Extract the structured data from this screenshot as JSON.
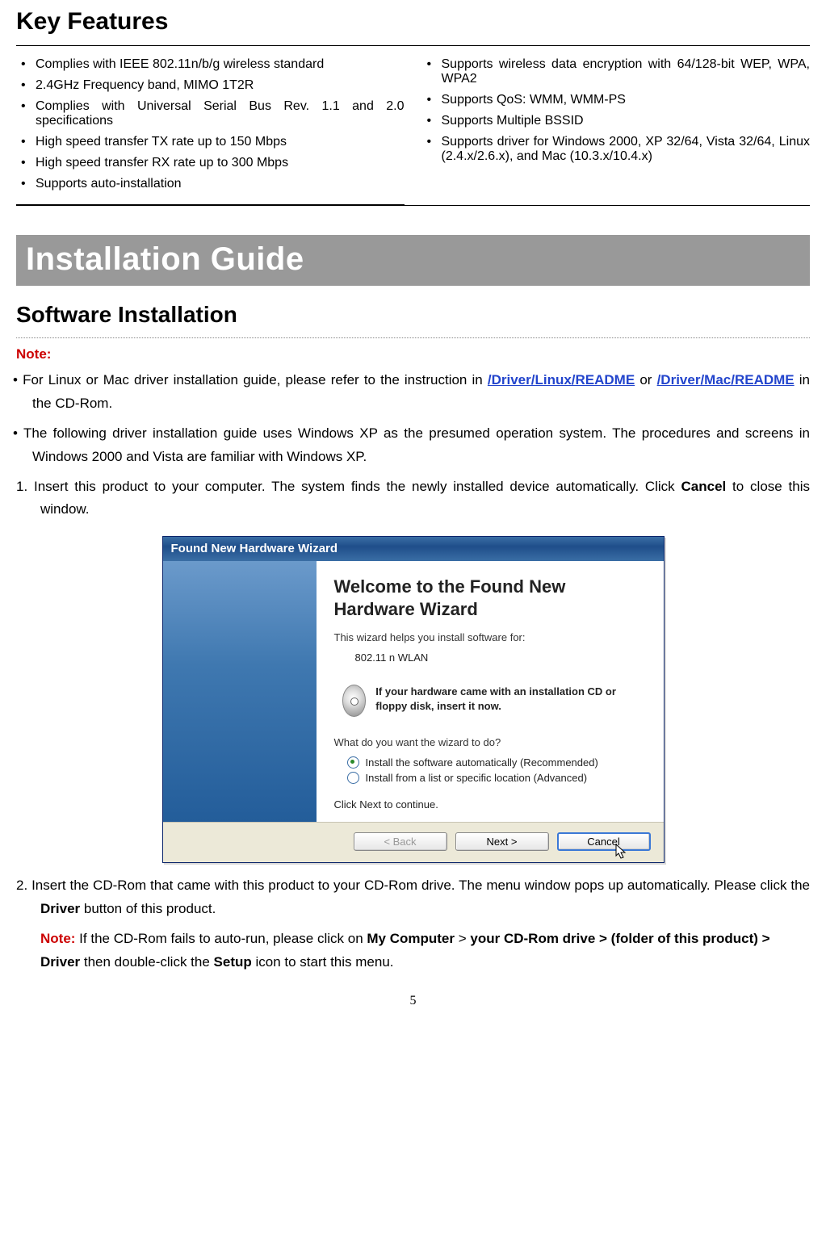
{
  "keyFeaturesHeading": "Key Features",
  "featuresLeft": [
    "Complies with IEEE 802.11n/b/g wireless standard",
    "2.4GHz Frequency band, MIMO 1T2R",
    "Complies with Universal Serial Bus Rev. 1.1 and 2.0 specifications",
    "High speed transfer TX rate up to 150 Mbps",
    "High speed transfer RX rate up to 300 Mbps",
    "Supports auto-installation"
  ],
  "featuresRight": [
    "Supports wireless data encryption with 64/128-bit WEP, WPA, WPA2",
    "Supports QoS: WMM, WMM-PS",
    "Supports Multiple BSSID",
    "Supports driver for Windows 2000, XP 32/64, Vista 32/64, Linux (2.4.x/2.6.x), and Mac (10.3.x/10.4.x)"
  ],
  "installGuideHeading": "Installation Guide",
  "softwareHeading": "Software Installation",
  "noteLabel": "Note:",
  "note1_pre": "• For Linux or Mac driver installation guide, please refer to the instruction in ",
  "note1_link1": "/Driver/Linux/README",
  "note1_mid": " or ",
  "note1_link2": "/Driver/Mac/README",
  "note1_post": " in the CD-Rom.",
  "note2": "• The following driver installation guide uses Windows XP as the presumed operation system. The procedures and screens in Windows 2000 and Vista are familiar with Windows XP.",
  "step1_pre": "1.  Insert this product to your computer. The system finds the newly installed device automatically. Click ",
  "step1_bold": "Cancel",
  "step1_post": " to close this window.",
  "wizard": {
    "title": "Found New Hardware Wizard",
    "welcome": "Welcome to the Found New Hardware Wizard",
    "helps": "This wizard helps you install software for:",
    "device": "802.11 n WLAN",
    "cdText": "If your hardware came with an installation CD or floppy disk, insert it now.",
    "question": "What do you want the wizard to do?",
    "opt1": "Install the software automatically (Recommended)",
    "opt2": "Install from a list or specific location (Advanced)",
    "continue": "Click Next to continue.",
    "btnBack": "< Back",
    "btnNext": "Next >",
    "btnCancel": "Cancel"
  },
  "step2_pre": "2.   Insert the CD-Rom that came with this product to your CD-Rom drive. The menu window pops up automatically. Please click the ",
  "step2_b1": "Driver",
  "step2_mid": " button of this product.",
  "step2_noteLabel": "Note:",
  "step2_note_a": " If the CD-Rom fails to auto-run, please click on ",
  "step2_b2": "My Computer",
  "step2_gt1": " > ",
  "step2_b3": "your CD-Rom drive > (folder of this product) > Driver",
  "step2_note_b": " then double-click the ",
  "step2_b4": "Setup",
  "step2_note_c": " icon to start this menu.",
  "pageNumber": "5"
}
